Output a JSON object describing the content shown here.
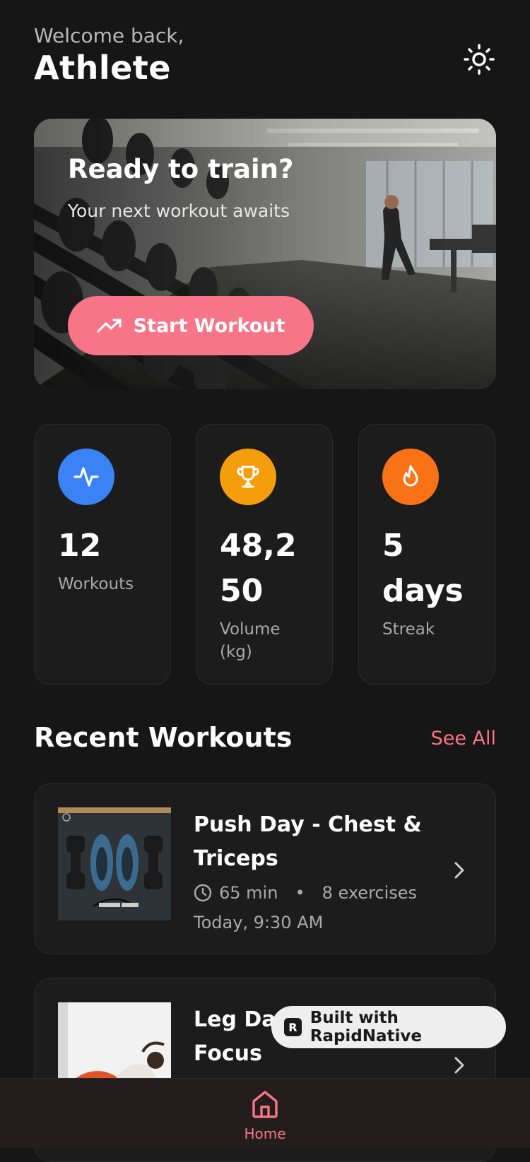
{
  "header": {
    "greeting": "Welcome back,",
    "name": "Athlete",
    "theme_icon": "sun-icon"
  },
  "hero": {
    "title": "Ready to train?",
    "subtitle": "Your next workout awaits",
    "button_label": "Start Workout",
    "button_icon": "trending-up-icon"
  },
  "stats": [
    {
      "value": "12",
      "label": "Workouts",
      "icon": "activity-icon",
      "color": "#3b82f6"
    },
    {
      "value": "48,250",
      "label": "Volume (kg)",
      "icon": "trophy-icon",
      "color": "#f59e0b"
    },
    {
      "value": "5 days",
      "label": "Streak",
      "icon": "flame-icon",
      "color": "#f97316"
    }
  ],
  "recent": {
    "title": "Recent Workouts",
    "see_all": "See All",
    "items": [
      {
        "title": "Push Day - Chest & Triceps",
        "duration": "65 min",
        "exercises": "8 exercises",
        "date": "Today, 9:30 AM"
      },
      {
        "title": "Leg Day Focus"
      }
    ]
  },
  "badge": {
    "label": "Built with RapidNative"
  },
  "tabs": [
    {
      "label": "Home",
      "icon": "home-icon"
    }
  ],
  "colors": {
    "accent": "#f87487",
    "background": "#161616",
    "card": "#1c1c1c"
  }
}
